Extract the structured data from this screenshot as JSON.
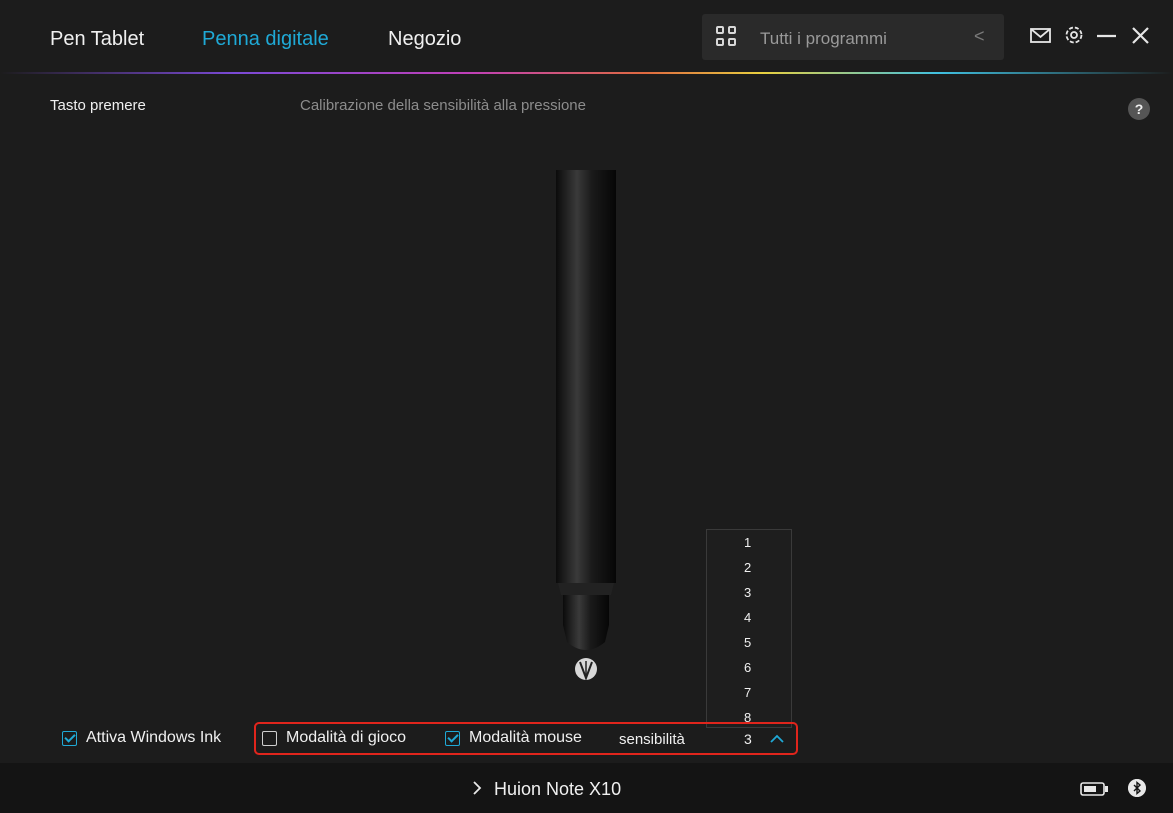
{
  "header": {
    "tabs": [
      {
        "label": "Pen Tablet"
      },
      {
        "label": "Penna digitale",
        "active": true
      },
      {
        "label": "Negozio"
      }
    ],
    "programs_label": "Tutti i programmi",
    "back_glyph": "<",
    "icons": [
      "grid-icon",
      "mail-icon",
      "gear-icon",
      "minimize-icon",
      "close-icon"
    ],
    "accent_color": "#1fa9d6"
  },
  "subheader": {
    "left": "Tasto premere",
    "center": "Calibrazione della sensibilità alla pressione",
    "help": "?"
  },
  "sensitivity": {
    "label": "sensibilità",
    "value": "3",
    "options": [
      "1",
      "2",
      "3",
      "4",
      "5",
      "6",
      "7",
      "8"
    ]
  },
  "options": {
    "windows_ink": {
      "label": "Attiva Windows Ink",
      "checked": true
    },
    "game_mode": {
      "label": "Modalità di gioco",
      "checked": false
    },
    "mouse_mode": {
      "label": "Modalità mouse",
      "checked": true
    }
  },
  "footer": {
    "device": "Huion Note X10",
    "icons": [
      "chevron-right-icon",
      "battery-icon",
      "bluetooth-icon"
    ]
  }
}
